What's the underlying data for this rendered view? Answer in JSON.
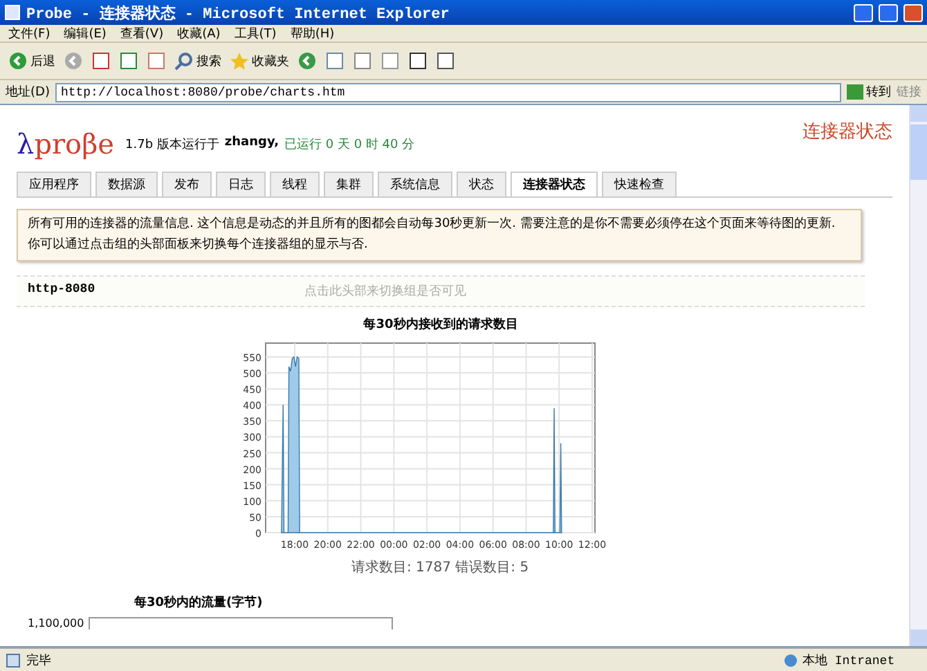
{
  "window": {
    "title": "Probe - 连接器状态 - Microsoft Internet Explorer"
  },
  "menu": [
    "文件(F)",
    "编辑(E)",
    "查看(V)",
    "收藏(A)",
    "工具(T)",
    "帮助(H)"
  ],
  "toolbar": {
    "back": "后退",
    "search": "搜索",
    "favorites": "收藏夹"
  },
  "address_bar": {
    "label": "地址(D)",
    "value": "http://localhost:8080/probe/charts.htm",
    "go": "转到",
    "links": "链接"
  },
  "page": {
    "logo": "λproβe",
    "version": "1.7b 版本运行于",
    "user": "zhangy,",
    "uptime": "已运行 0 天 0 时 40 分",
    "heading": "连接器状态",
    "tabs": [
      {
        "label": "应用程序",
        "selected": false
      },
      {
        "label": "数据源",
        "selected": false
      },
      {
        "label": "发布",
        "selected": false
      },
      {
        "label": "日志",
        "selected": false
      },
      {
        "label": "线程",
        "selected": false
      },
      {
        "label": "集群",
        "selected": false
      },
      {
        "label": "系统信息",
        "selected": false
      },
      {
        "label": "状态",
        "selected": false
      },
      {
        "label": "连接器状态",
        "selected": true
      },
      {
        "label": "快速检查",
        "selected": false
      }
    ],
    "info": "所有可用的连接器的流量信息. 这个信息是动态的并且所有的图都会自动每30秒更新一次. 需要注意的是你不需要必须停在这个页面来等待图的更新. 你可以通过点击组的头部面板来切换每个连接器组的显示与否.",
    "group": {
      "name": "http-8080",
      "hint": "点击此头部来切换组是否可见",
      "requests_chart": {
        "title": "每30秒内接收到的请求数目",
        "summary": "请求数目: 1787  错误数目: 5",
        "x_axis_labels": [
          "18:00",
          "20:00",
          "22:00",
          "00:00",
          "02:00",
          "04:00",
          "06:00",
          "08:00",
          "10:00",
          "12:00"
        ],
        "y_axis_labels": [
          "550",
          "500",
          "450",
          "400",
          "350",
          "300",
          "250",
          "200",
          "150",
          "100",
          "50",
          "0"
        ]
      },
      "traffic_chart": {
        "title": "每30秒内的流量(字节)",
        "axis_label": "1,100,000"
      }
    }
  },
  "status_bar": {
    "text": "完毕",
    "zone": "本地 Intranet"
  }
}
